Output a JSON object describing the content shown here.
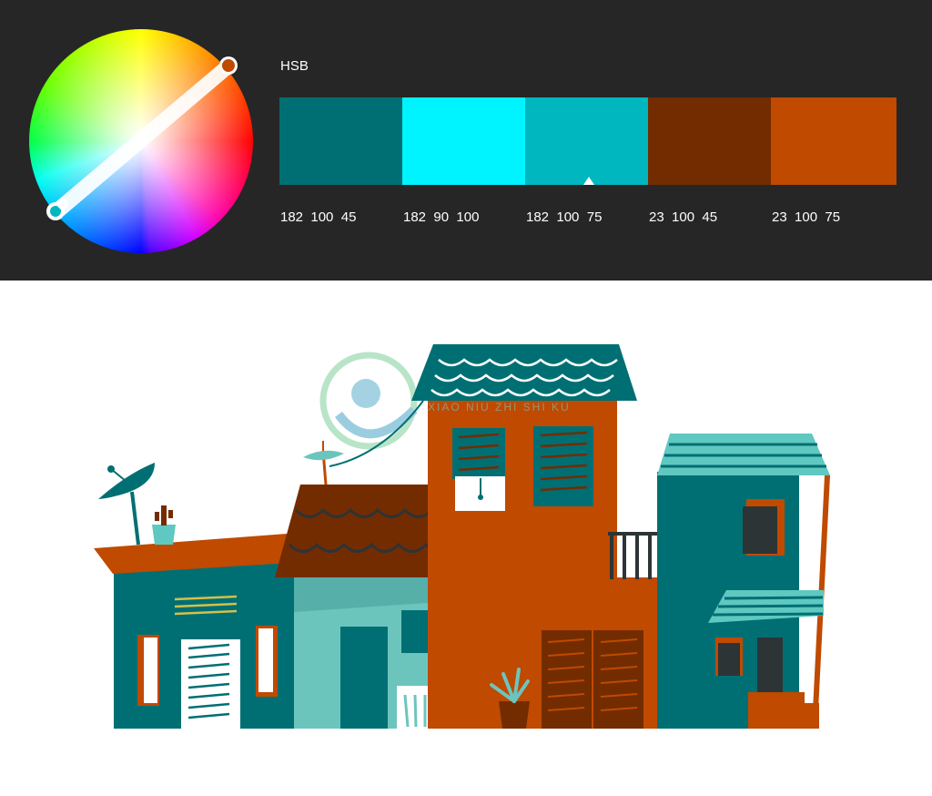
{
  "color_mode": "HSB",
  "swatches": [
    {
      "color": "#006f73",
      "hsb": "182  100  45"
    },
    {
      "color": "#00f4ff",
      "hsb": "182  90  100"
    },
    {
      "color": "#00b7bf",
      "hsb": "182  100  75"
    },
    {
      "color": "#732c00",
      "hsb": "23  100  45"
    },
    {
      "color": "#bf4a00",
      "hsb": "23  100  75"
    }
  ],
  "selected_swatch_index": 2,
  "wheel": {
    "handle_primary_color": "#bf4a00",
    "handle_secondary_color": "#00b7bf"
  },
  "watermark": {
    "text": "XIAO NIU ZHI SHI KU"
  },
  "icons": {
    "color_wheel": "color-wheel-icon",
    "selection_marker": "triangle-up-icon"
  }
}
